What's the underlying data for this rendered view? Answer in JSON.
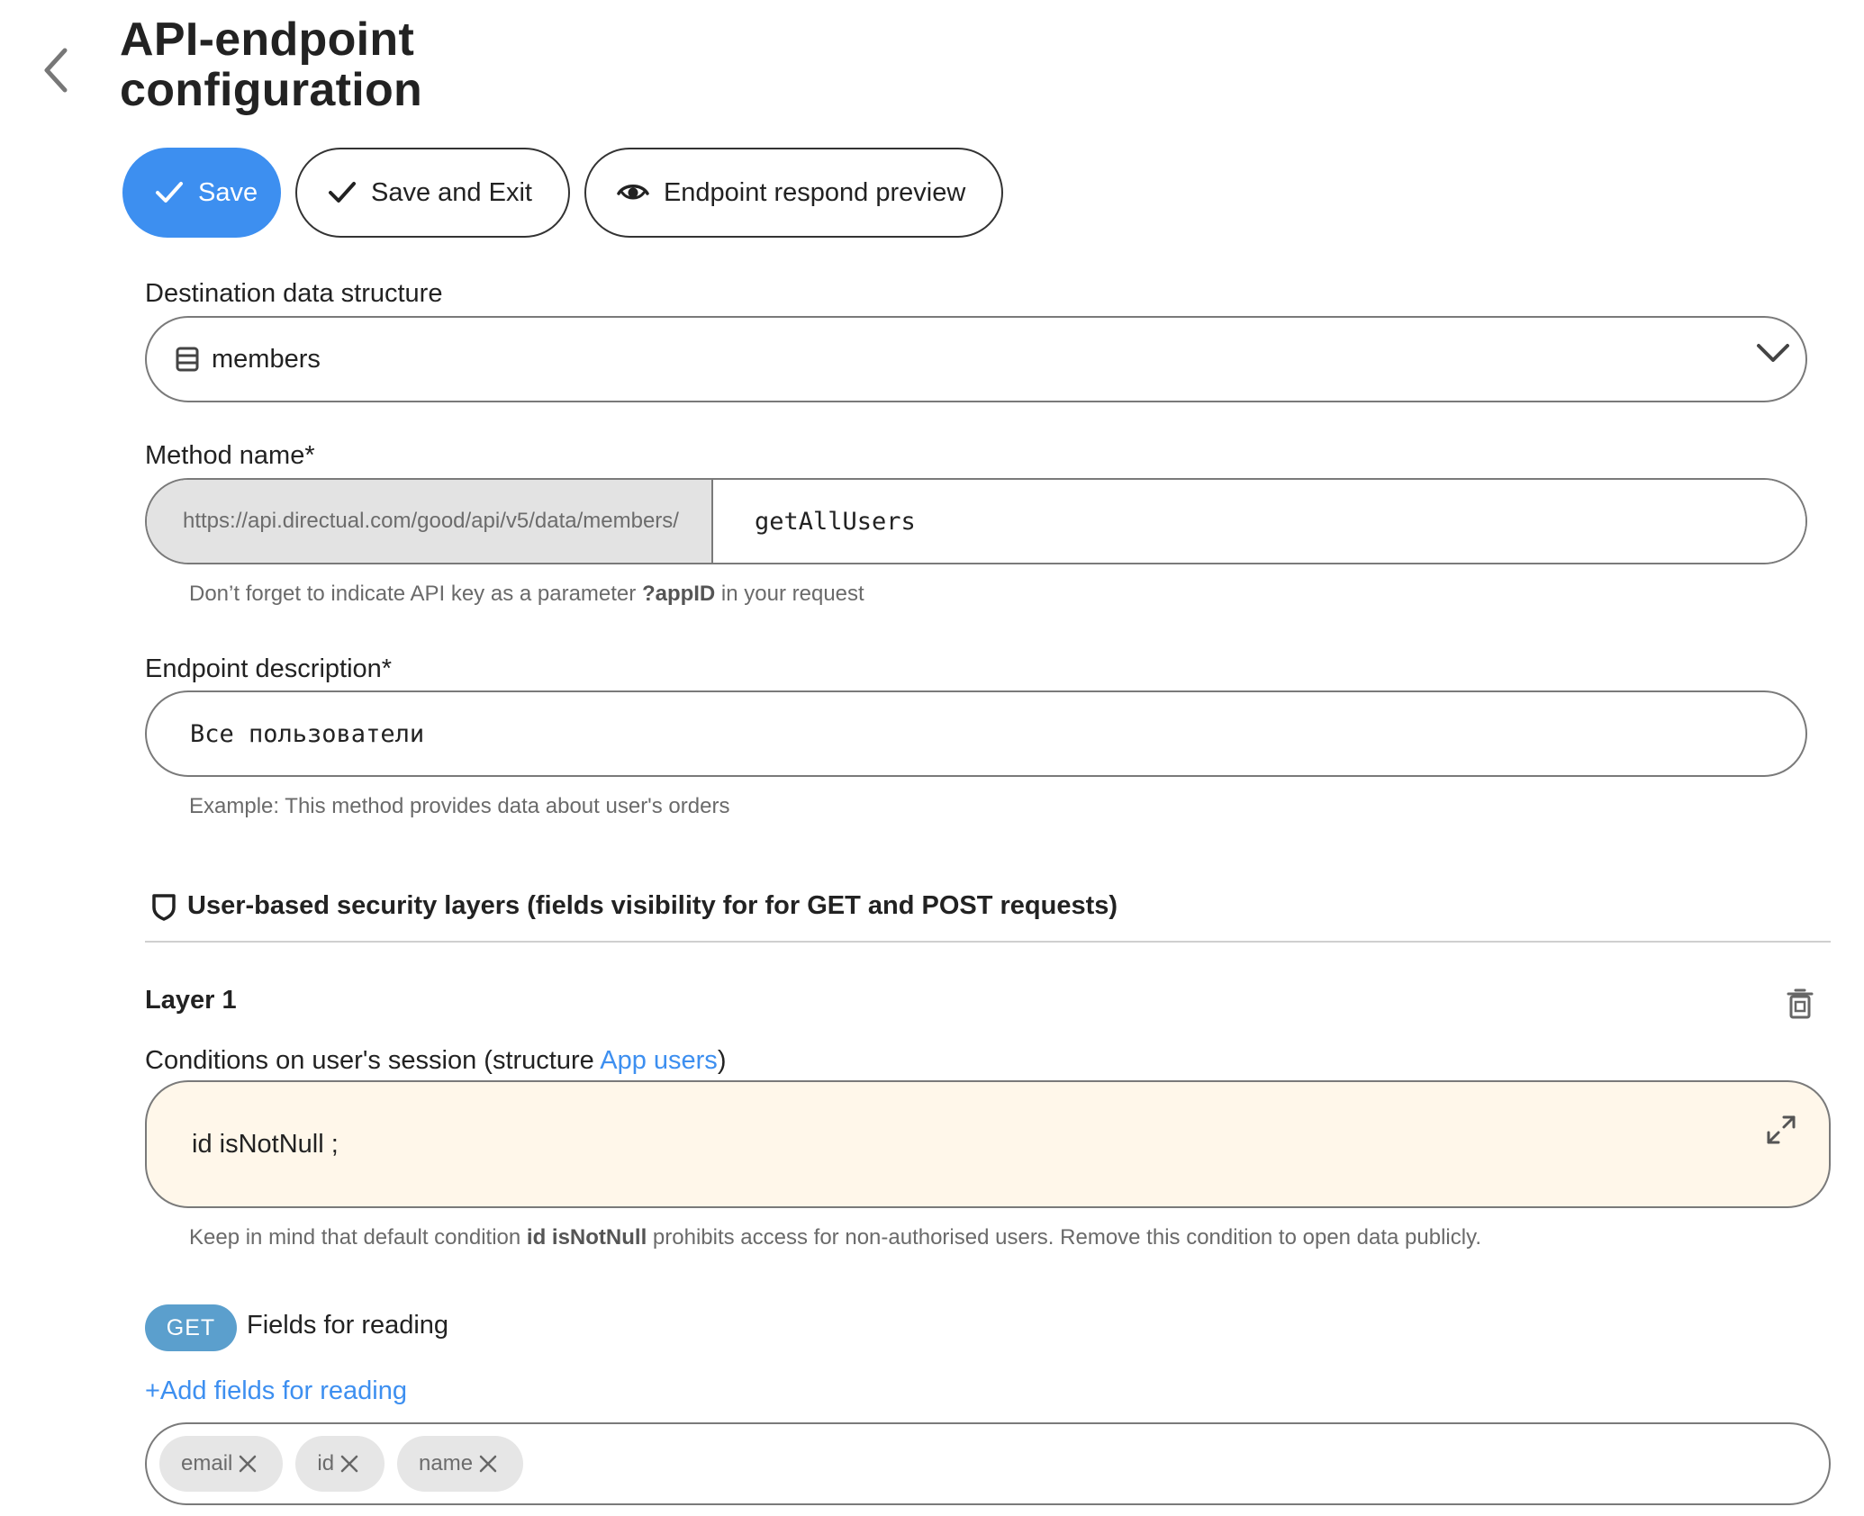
{
  "page": {
    "title_line1": "API-endpoint",
    "title_line2": "configuration"
  },
  "toolbar": {
    "save_label": "Save",
    "save_exit_label": "Save and Exit",
    "preview_label": "Endpoint respond preview"
  },
  "destination": {
    "label": "Destination data structure",
    "value": "members"
  },
  "method": {
    "label": "Method name*",
    "url_prefix": "https://api.directual.com/good/api/v5/data/members/",
    "value": "getAllUsers",
    "hint_before": "Don’t forget to indicate API key as a parameter ",
    "hint_bold": "?appID",
    "hint_after": " in your request"
  },
  "description": {
    "label": "Endpoint description*",
    "value": "Все пользователи",
    "hint": "Example: This method provides data about user's orders"
  },
  "security": {
    "heading": "User-based security layers (fields visibility for for GET and POST requests)",
    "layer_title": "Layer 1",
    "conditions_label_before": "Conditions on user's session (structure ",
    "conditions_link": "App users",
    "conditions_label_after": ")",
    "condition_value": "id isNotNull ;",
    "hint_before": "Keep in mind that default condition ",
    "hint_bold": "id isNotNull",
    "hint_after": " prohibits access for non-authorised users. Remove this condition to open data publicly."
  },
  "reading": {
    "badge": "GET",
    "label": "Fields for reading",
    "add_link": "+Add fields for reading",
    "tags": [
      "email",
      "id",
      "name"
    ]
  },
  "colors": {
    "accent": "#3d8ff0",
    "get_badge": "#5b9fcd",
    "condition_bg": "#fff7ea"
  }
}
